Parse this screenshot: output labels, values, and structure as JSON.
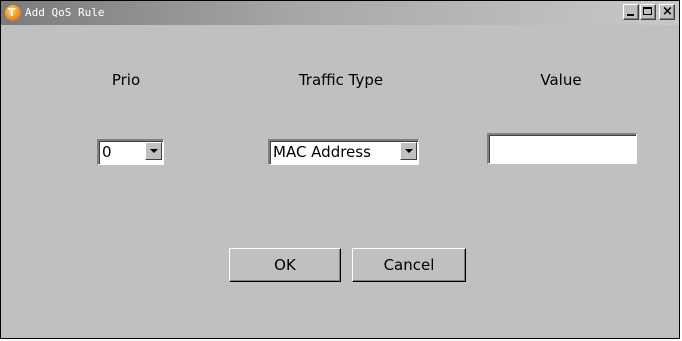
{
  "window": {
    "title": "Add QoS Rule",
    "icon": "app-logo-icon",
    "icon_letter": "T",
    "controls": [
      "minimize-icon",
      "maximize-icon",
      "close-icon"
    ],
    "close_glyph": "×"
  },
  "form": {
    "prio_label": "Prio",
    "traffic_type_label": "Traffic Type",
    "value_label": "Value",
    "prio_selected": "0",
    "traffic_type_selected": "MAC Address",
    "value_text": ""
  },
  "buttons": {
    "ok_label": "OK",
    "cancel_label": "Cancel"
  },
  "colors": {
    "face": "#c0c0c0",
    "title_gradient_start": "#7b7b7b",
    "icon_accent": "#f08a1c"
  }
}
